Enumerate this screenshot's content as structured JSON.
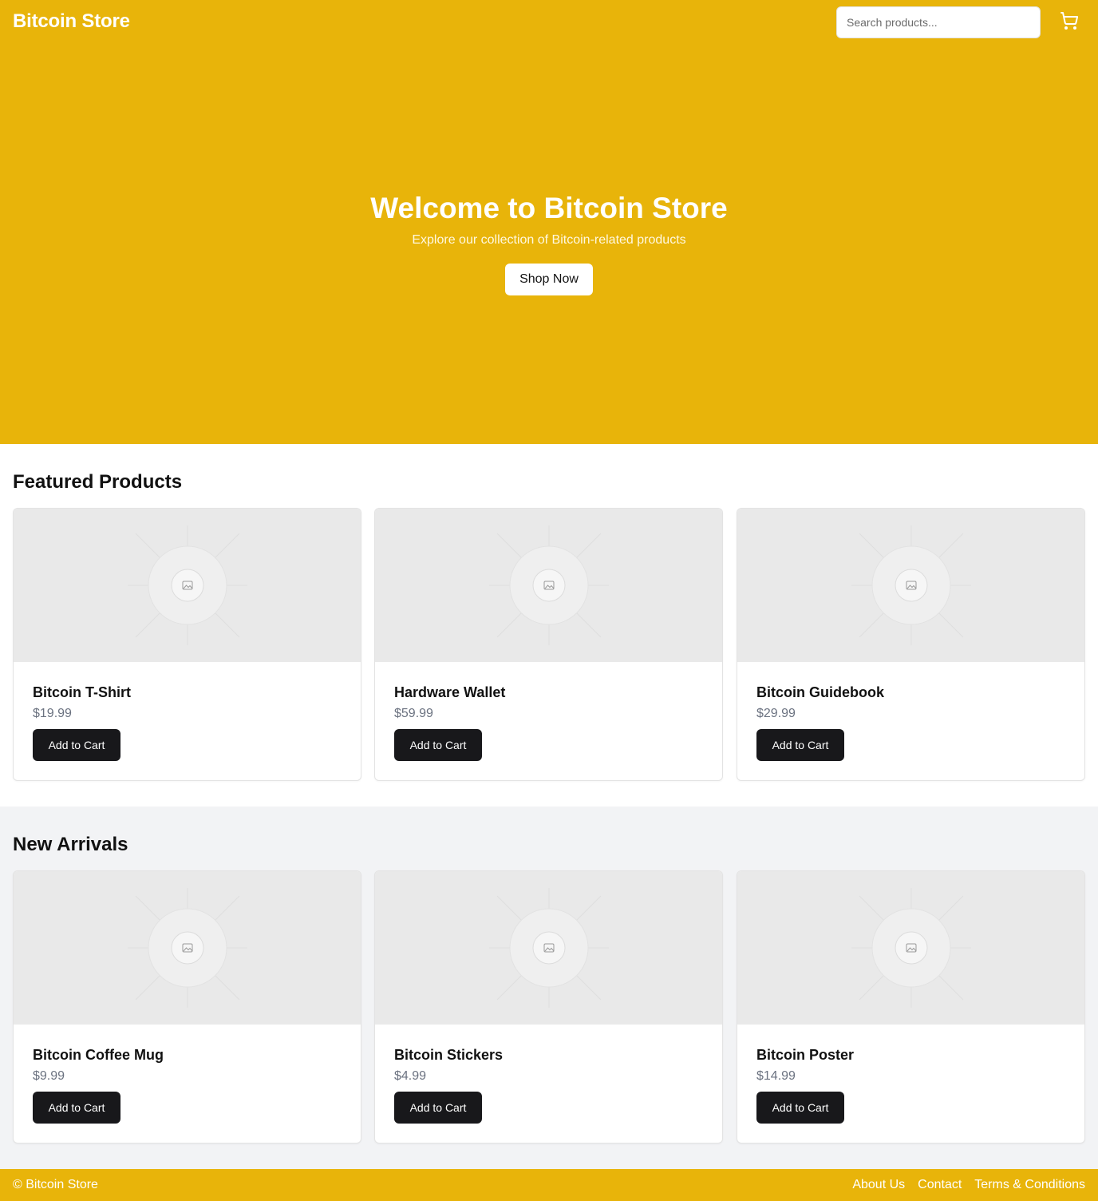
{
  "header": {
    "brand": "Bitcoin Store",
    "search_placeholder": "Search products...",
    "cart_icon": "shopping-cart-icon"
  },
  "hero": {
    "title": "Welcome to Bitcoin Store",
    "subtitle": "Explore our collection of Bitcoin-related products",
    "cta_label": "Shop Now"
  },
  "featured": {
    "title": "Featured Products",
    "products": [
      {
        "name": "Bitcoin T-Shirt",
        "price": "$19.99",
        "button": "Add to Cart"
      },
      {
        "name": "Hardware Wallet",
        "price": "$59.99",
        "button": "Add to Cart"
      },
      {
        "name": "Bitcoin Guidebook",
        "price": "$29.99",
        "button": "Add to Cart"
      }
    ]
  },
  "arrivals": {
    "title": "New Arrivals",
    "products": [
      {
        "name": "Bitcoin Coffee Mug",
        "price": "$9.99",
        "button": "Add to Cart"
      },
      {
        "name": "Bitcoin Stickers",
        "price": "$4.99",
        "button": "Add to Cart"
      },
      {
        "name": "Bitcoin Poster",
        "price": "$14.99",
        "button": "Add to Cart"
      }
    ]
  },
  "footer": {
    "copyright": "© Bitcoin Store",
    "links": [
      "About Us",
      "Contact",
      "Terms & Conditions"
    ]
  },
  "colors": {
    "brand": "#e8b40a",
    "button_dark": "#18181b",
    "section_alt_bg": "#f2f3f5",
    "price_text": "#6b7280"
  }
}
